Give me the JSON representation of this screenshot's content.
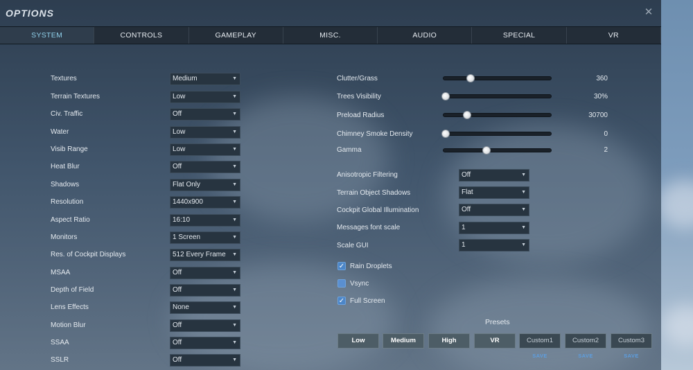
{
  "window": {
    "title": "OPTIONS",
    "close_icon": "close-icon"
  },
  "tabs": [
    {
      "label": "SYSTEM",
      "active": true
    },
    {
      "label": "CONTROLS",
      "active": false
    },
    {
      "label": "GAMEPLAY",
      "active": false
    },
    {
      "label": "MISC.",
      "active": false
    },
    {
      "label": "AUDIO",
      "active": false
    },
    {
      "label": "SPECIAL",
      "active": false
    },
    {
      "label": "VR",
      "active": false
    }
  ],
  "left_settings": [
    {
      "label": "Textures",
      "value": "Medium"
    },
    {
      "label": "Terrain Textures",
      "value": "Low"
    },
    {
      "label": "Civ. Traffic",
      "value": "Off"
    },
    {
      "label": "Water",
      "value": "Low"
    },
    {
      "label": "Visib Range",
      "value": "Low"
    },
    {
      "label": "Heat Blur",
      "value": "Off"
    },
    {
      "label": "Shadows",
      "value": "Flat Only"
    },
    {
      "label": "Resolution",
      "value": "1440x900"
    },
    {
      "label": "Aspect Ratio",
      "value": "16:10"
    },
    {
      "label": "Monitors",
      "value": "1 Screen"
    },
    {
      "label": "Res. of Cockpit Displays",
      "value": "512 Every Frame"
    },
    {
      "label": "MSAA",
      "value": "Off"
    },
    {
      "label": "Depth of Field",
      "value": "Off"
    },
    {
      "label": "Lens Effects",
      "value": "None"
    },
    {
      "label": "Motion Blur",
      "value": "Off"
    },
    {
      "label": "SSAA",
      "value": "Off"
    },
    {
      "label": "SSLR",
      "value": "Off"
    }
  ],
  "sliders": [
    {
      "label": "Clutter/Grass",
      "value": "360",
      "fraction": 0.25
    },
    {
      "label": "Trees Visibility",
      "value": "30%",
      "fraction": 0.02
    },
    {
      "label": "Preload Radius",
      "value": "30700",
      "fraction": 0.22
    },
    {
      "label": "Chimney Smoke Density",
      "value": "0",
      "fraction": 0.02
    },
    {
      "label": "Gamma",
      "value": "2",
      "fraction": 0.4
    }
  ],
  "right_settings": [
    {
      "label": "Anisotropic Filtering",
      "value": "Off"
    },
    {
      "label": "Terrain Object Shadows",
      "value": "Flat"
    },
    {
      "label": "Cockpit Global Illumination",
      "value": "Off"
    },
    {
      "label": "Messages font scale",
      "value": "1"
    },
    {
      "label": "Scale GUI",
      "value": "1"
    }
  ],
  "checkboxes": [
    {
      "label": "Rain Droplets",
      "checked": true
    },
    {
      "label": "Vsync",
      "checked": false
    },
    {
      "label": "Full Screen",
      "checked": true
    }
  ],
  "presets": {
    "title": "Presets",
    "buttons": [
      {
        "label": "Low",
        "custom": false,
        "save": ""
      },
      {
        "label": "Medium",
        "custom": false,
        "save": ""
      },
      {
        "label": "High",
        "custom": false,
        "save": ""
      },
      {
        "label": "VR",
        "custom": false,
        "save": ""
      },
      {
        "label": "Custom1",
        "custom": true,
        "save": "SAVE"
      },
      {
        "label": "Custom2",
        "custom": true,
        "save": "SAVE"
      },
      {
        "label": "Custom3",
        "custom": true,
        "save": "SAVE"
      }
    ]
  },
  "colors": {
    "active_tab_text": "#8fd0ea",
    "checkbox": "#4c86c8",
    "save_link": "#5d9ee0"
  }
}
